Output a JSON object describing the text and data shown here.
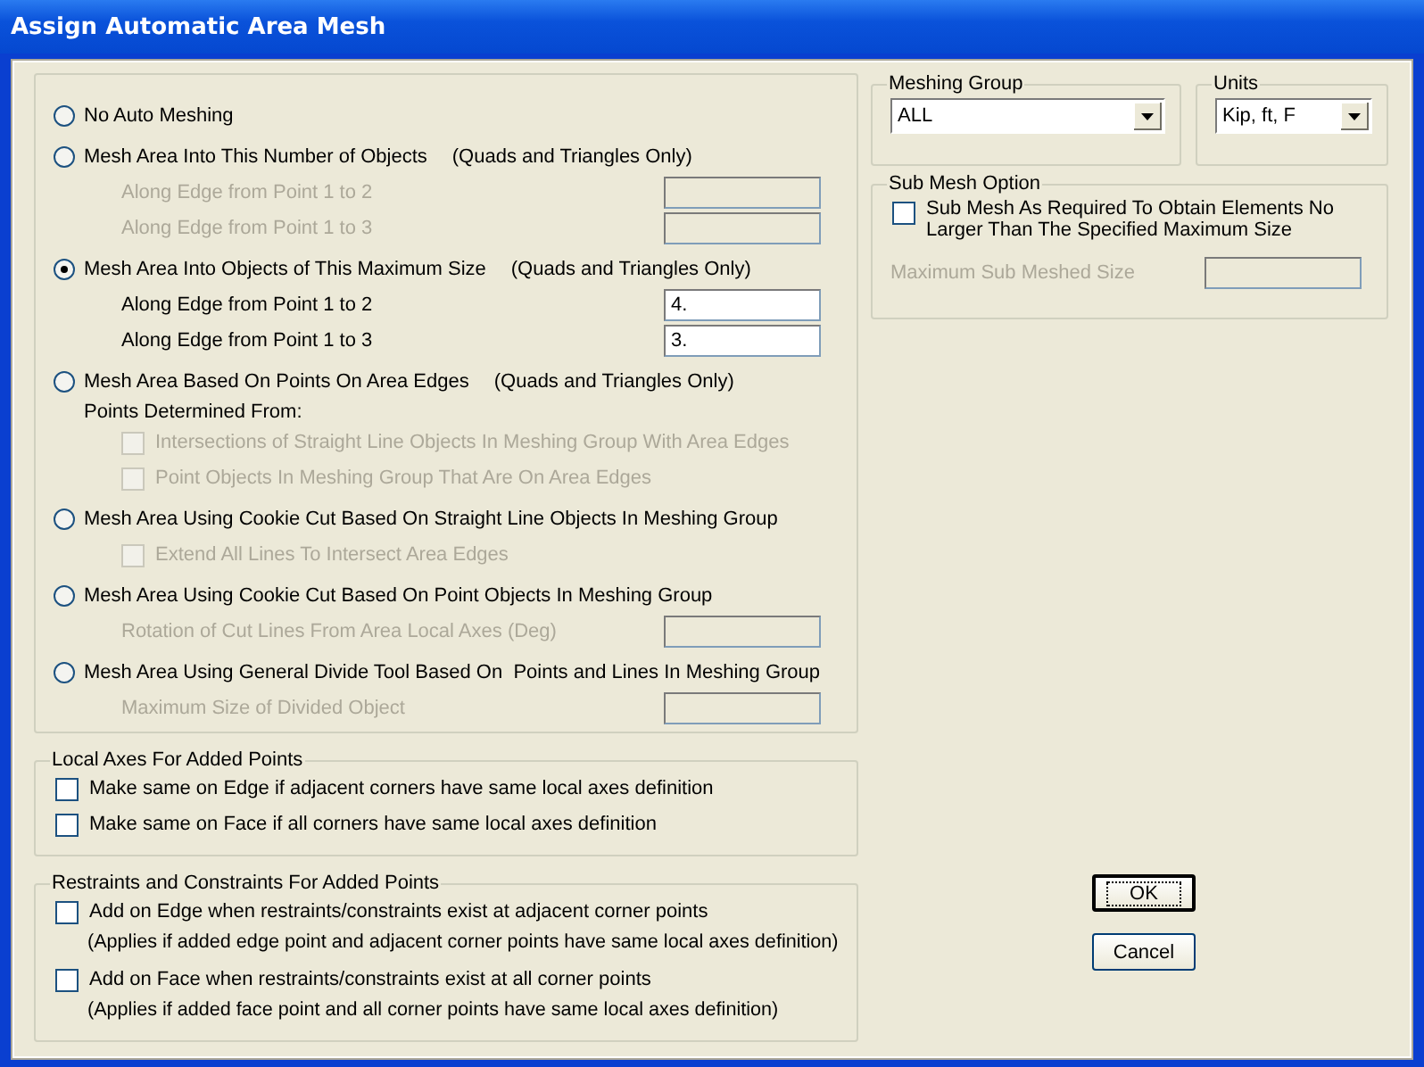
{
  "window": {
    "title": "Assign Automatic Area Mesh"
  },
  "mesh_options": [
    {
      "label": "No Auto Meshing",
      "selected": false
    },
    {
      "label": "Mesh Area Into This Number of Objects",
      "note": "(Quads and Triangles Only)",
      "selected": false,
      "items": [
        {
          "kind": "field",
          "label": "Along Edge from Point 1 to 2",
          "disabled": true
        },
        {
          "kind": "field",
          "label": "Along Edge from Point 1 to 3",
          "disabled": true
        }
      ]
    },
    {
      "label": "Mesh Area Into Objects of This Maximum Size",
      "note": "(Quads and Triangles Only)",
      "selected": true,
      "items": [
        {
          "kind": "field",
          "label": "Along Edge from Point 1 to 2",
          "value": "4.",
          "disabled": false
        },
        {
          "kind": "field",
          "label": "Along Edge from Point 1 to 3",
          "value": "3.",
          "disabled": false
        }
      ]
    },
    {
      "label": "Mesh Area Based On Points On Area Edges",
      "note": "(Quads and Triangles Only)",
      "selected": false,
      "items": [
        {
          "kind": "caption",
          "label": "Points Determined From:"
        },
        {
          "kind": "checkbox",
          "label": "Intersections of Straight Line Objects In Meshing Group With Area Edges",
          "checked": false,
          "disabled": true
        },
        {
          "kind": "checkbox",
          "label": "Point Objects In Meshing Group That Are On Area Edges",
          "checked": false,
          "disabled": true
        }
      ]
    },
    {
      "label": "Mesh Area Using Cookie Cut Based On Straight Line Objects In Meshing Group",
      "selected": false,
      "items": [
        {
          "kind": "checkbox",
          "label": "Extend All Lines To Intersect Area Edges",
          "checked": false,
          "disabled": true
        }
      ]
    },
    {
      "label": "Mesh Area Using Cookie Cut Based On Point Objects In Meshing Group",
      "selected": false,
      "items": [
        {
          "kind": "field",
          "label": "Rotation of Cut Lines From Area Local Axes (Deg)",
          "disabled": true
        }
      ]
    },
    {
      "label": "Mesh Area Using General Divide Tool Based On  Points and Lines In Meshing Group",
      "selected": false,
      "items": [
        {
          "kind": "field",
          "label": "Maximum Size of Divided Object",
          "disabled": true
        }
      ]
    }
  ],
  "local_axes": {
    "title": "Local Axes For Added Points",
    "options": [
      {
        "label": "Make same on Edge if adjacent corners have same local axes definition",
        "checked": false
      },
      {
        "label": "Make same on Face if all corners have same local axes definition",
        "checked": false
      }
    ]
  },
  "restraints": {
    "title": "Restraints and Constraints For Added Points",
    "options": [
      {
        "label": "Add on Edge when restraints/constraints exist at adjacent corner points",
        "note": "(Applies if added edge point and adjacent corner points have same local axes definition)",
        "checked": false
      },
      {
        "label": "Add on Face when restraints/constraints exist at all corner points",
        "note": "(Applies if added face point and all corner points have same local axes definition)",
        "checked": false
      }
    ]
  },
  "meshing_group": {
    "title": "Meshing Group",
    "value": "ALL"
  },
  "units": {
    "title": "Units",
    "value": "Kip, ft, F"
  },
  "sub_mesh": {
    "title": "Sub Mesh Option",
    "checkbox": {
      "label": "Sub Mesh As Required To Obtain Elements No Larger Than The Specified Maximum Size",
      "checked": false
    },
    "field": {
      "label": "Maximum Sub Meshed Size",
      "disabled": true
    }
  },
  "buttons": [
    {
      "label": "OK",
      "default": true
    },
    {
      "label": "Cancel",
      "default": false
    }
  ]
}
